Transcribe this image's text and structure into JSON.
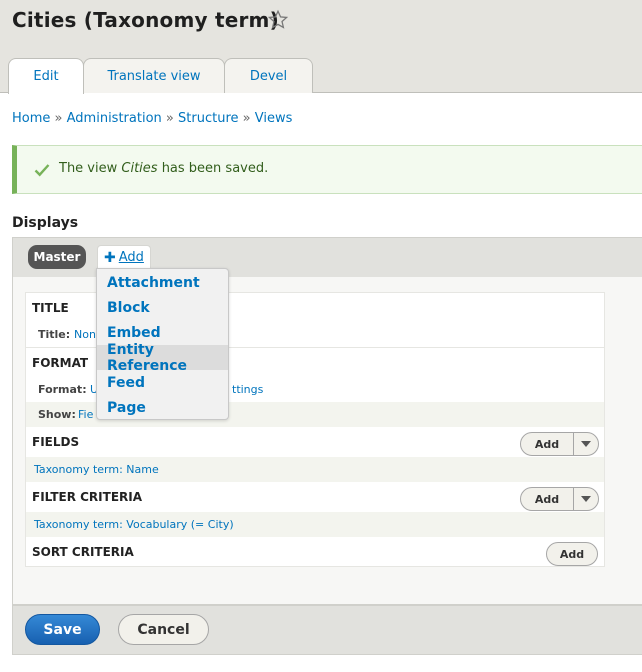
{
  "page": {
    "title": "Cities (Taxonomy term)"
  },
  "tabs": [
    {
      "label": "Edit"
    },
    {
      "label": "Translate view"
    },
    {
      "label": "Devel"
    }
  ],
  "breadcrumb": {
    "items": [
      "Home",
      "Administration",
      "Structure",
      "Views"
    ],
    "separator": "»"
  },
  "message": {
    "prefix": "The view ",
    "name": "Cities",
    "suffix": " has been saved."
  },
  "displays": {
    "heading": "Displays",
    "master_label": "Master",
    "add_label": "Add",
    "dropdown": [
      "Attachment",
      "Block",
      "Embed",
      "Entity Reference",
      "Feed",
      "Page"
    ],
    "hovered_item": "Entity Reference"
  },
  "sections": {
    "title": {
      "heading": "TITLE",
      "key": "Title:",
      "value": "Non"
    },
    "format": {
      "heading": "FORMAT",
      "format_key": "Format:",
      "format_value": "U",
      "settings_value": "ttings",
      "show_key": "Show:",
      "show_value": "Fie"
    },
    "fields": {
      "heading": "FIELDS",
      "item": "Taxonomy term: Name",
      "add_label": "Add"
    },
    "filter": {
      "heading": "FILTER CRITERIA",
      "item": "Taxonomy term: Vocabulary (= City)",
      "add_label": "Add"
    },
    "sort": {
      "heading": "SORT CRITERIA",
      "add_label": "Add"
    }
  },
  "footer": {
    "save_label": "Save",
    "cancel_label": "Cancel"
  },
  "colors": {
    "link": "#0074bd",
    "status_green": "#77b259",
    "primary_button": "#1a73c8"
  },
  "icons": {
    "favorite": "star-outline-icon",
    "status": "check-icon",
    "add": "plus-icon",
    "split": "caret-down-icon"
  }
}
